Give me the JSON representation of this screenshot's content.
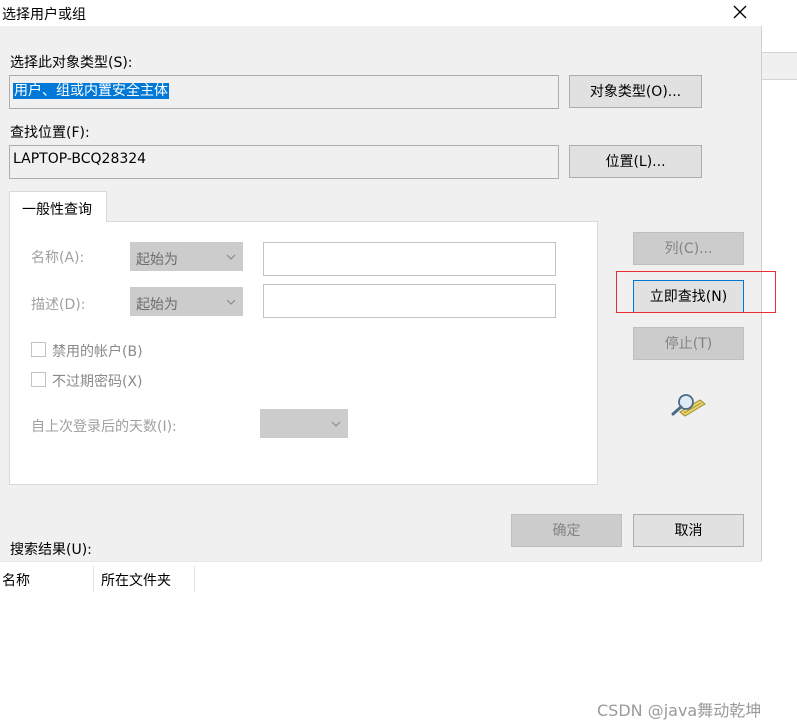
{
  "window": {
    "title": "选择用户或组"
  },
  "object_type": {
    "label": "选择此对象类型(S):",
    "value": "用户、组或内置安全主体",
    "button": "对象类型(O)..."
  },
  "location": {
    "label": "查找位置(F):",
    "value": "LAPTOP-BCQ28324",
    "button": "位置(L)..."
  },
  "tabs": [
    {
      "label": "一般性查询"
    }
  ],
  "query": {
    "name_label": "名称(A):",
    "name_mode": "起始为",
    "name_value": "",
    "desc_label": "描述(D):",
    "desc_mode": "起始为",
    "desc_value": "",
    "disabled_accounts": {
      "label": "禁用的帐户(B)",
      "checked": false
    },
    "non_expiring_pw": {
      "label": "不过期密码(X)",
      "checked": false
    },
    "days_label": "自上次登录后的天数(I):",
    "days_value": ""
  },
  "side_buttons": {
    "columns": "列(C)...",
    "find_now": "立即查找(N)",
    "stop": "停止(T)"
  },
  "dialog_buttons": {
    "ok": "确定",
    "cancel": "取消"
  },
  "results": {
    "label": "搜索结果(U):",
    "columns": [
      "名称",
      "所在文件夹"
    ]
  },
  "watermark": "CSDN @java舞动乾坤",
  "colors": {
    "selection": "#0078d7",
    "highlight_box": "#e6312f",
    "dialog_bg": "#f0f0f0"
  }
}
